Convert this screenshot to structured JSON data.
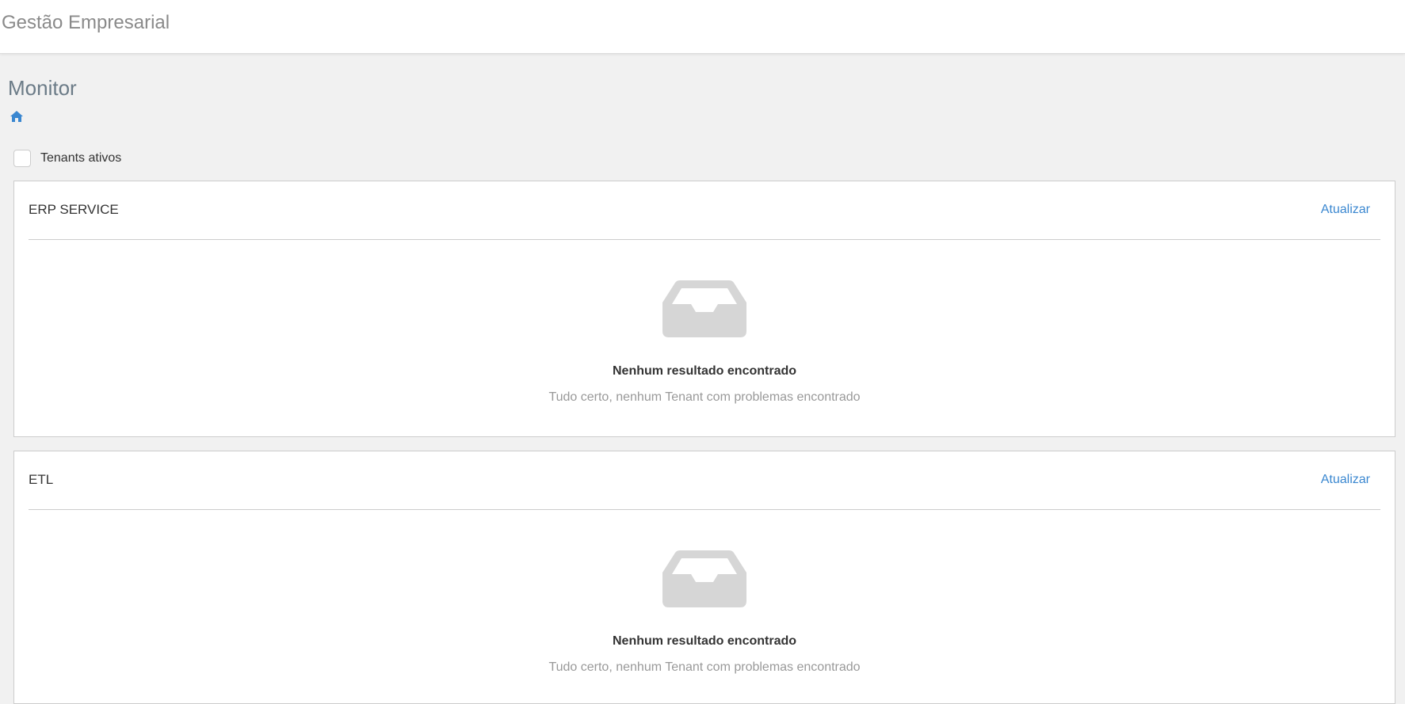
{
  "header": {
    "app_title": "Gestão Empresarial"
  },
  "page": {
    "title": "Monitor",
    "breadcrumb_icon": "home-icon"
  },
  "filter": {
    "label": "Tenants ativos",
    "checked": false
  },
  "panels": [
    {
      "title": "ERP SERVICE",
      "action": "Atualizar",
      "empty_title": "Nenhum resultado encontrado",
      "empty_subtitle": "Tudo certo, nenhum Tenant com problemas encontrado"
    },
    {
      "title": "ETL",
      "action": "Atualizar",
      "empty_title": "Nenhum resultado encontrado",
      "empty_subtitle": "Tudo certo, nenhum Tenant com problemas encontrado"
    }
  ],
  "colors": {
    "accent": "#3a87d0",
    "empty_icon": "#d6d6d6"
  }
}
